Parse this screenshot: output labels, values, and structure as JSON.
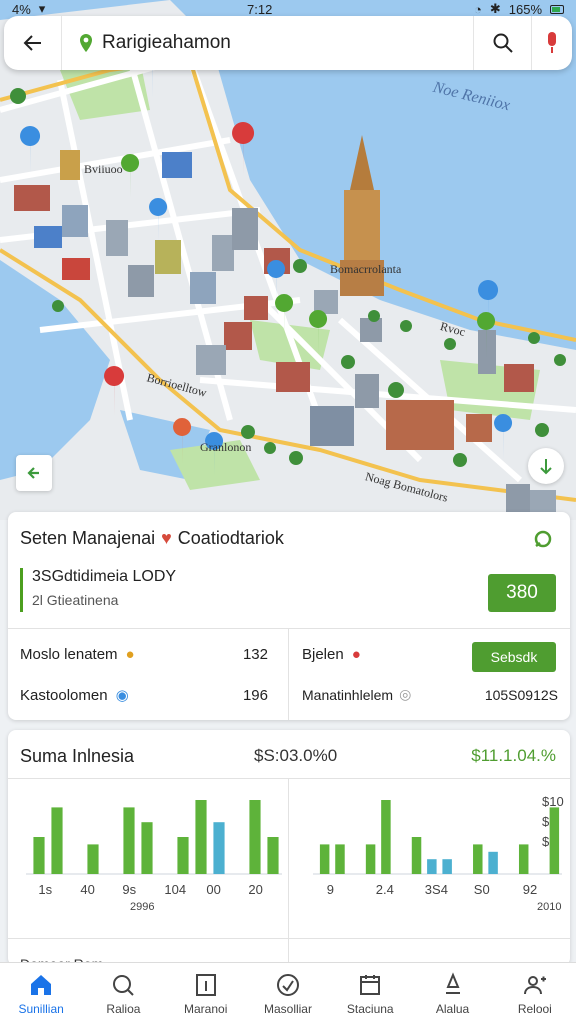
{
  "status_bar": {
    "time": "7:12",
    "left": "4%",
    "battery": "165%"
  },
  "search": {
    "query": "Rarigieahamon"
  },
  "map": {
    "labels": {
      "sea": "Noe Reniiox",
      "p1": "Bviiuoo",
      "landmark": "Bomacrrolanta",
      "p2": "Rvoc",
      "p3": "Granlonon",
      "road1": "Borrioelltow",
      "road2": "Noag Bomatolors"
    }
  },
  "card1": {
    "title": "Seten Manajenai",
    "title2": "Coatiodtariok",
    "sub1": "3SGdtidimeia LODY",
    "sub2": "2l Gtieatinena",
    "badge": "380",
    "rows": [
      {
        "label": "Moslo lenatem",
        "value": "132"
      },
      {
        "label": "Kastoolomen",
        "value": "196"
      },
      {
        "label": "Bjelen",
        "button": "Sebsdk"
      },
      {
        "label": "Manatinhlelem",
        "value": "105S0912S"
      }
    ]
  },
  "card2": {
    "title": "Suma Inlnesia",
    "value1": "$S:03.0%0",
    "value2": "$11.1.04.%",
    "peek": "Domeer Rom"
  },
  "chart_data": [
    {
      "type": "bar",
      "categories": [
        "1s",
        "40",
        "9s",
        "104",
        "00"
      ],
      "series": [
        {
          "values": [
            5,
            9,
            0,
            4,
            0,
            9,
            7,
            0,
            5,
            10,
            7,
            0,
            10,
            5
          ]
        }
      ],
      "tick_labels": [
        "1s",
        "40",
        "9s",
        "104",
        "00",
        "20"
      ],
      "extra_label": "2996",
      "colors": [
        "#5eb33a",
        "#4cb0d0"
      ]
    },
    {
      "type": "bar",
      "categories": [
        "9",
        "2.4",
        "3S4",
        "S0",
        "92"
      ],
      "series": [
        {
          "values": [
            4,
            4,
            0,
            4,
            10,
            0,
            5,
            2,
            2,
            0,
            4,
            3,
            0,
            4,
            0,
            9
          ]
        }
      ],
      "tick_labels": [
        "9",
        "2.4",
        "3S4",
        "S0",
        "92"
      ],
      "extra_label": "2010",
      "y_ticks": [
        "$10",
        "$",
        "$"
      ],
      "colors": [
        "#5eb33a",
        "#4cb0d0"
      ]
    }
  ],
  "nav": [
    {
      "label": "Sunillian",
      "icon": "home-icon",
      "active": true
    },
    {
      "label": "Ralioa",
      "icon": "search-icon"
    },
    {
      "label": "Maranoi",
      "icon": "map-icon"
    },
    {
      "label": "Masolliar",
      "icon": "clock-icon"
    },
    {
      "label": "Staciuna",
      "icon": "calendar-icon"
    },
    {
      "label": "Alalua",
      "icon": "pin-icon"
    },
    {
      "label": "Relooi",
      "icon": "people-icon"
    }
  ],
  "colors": {
    "accent_green": "#4f9d30",
    "accent_blue": "#1a73e8",
    "water": "#9cc9ef"
  }
}
